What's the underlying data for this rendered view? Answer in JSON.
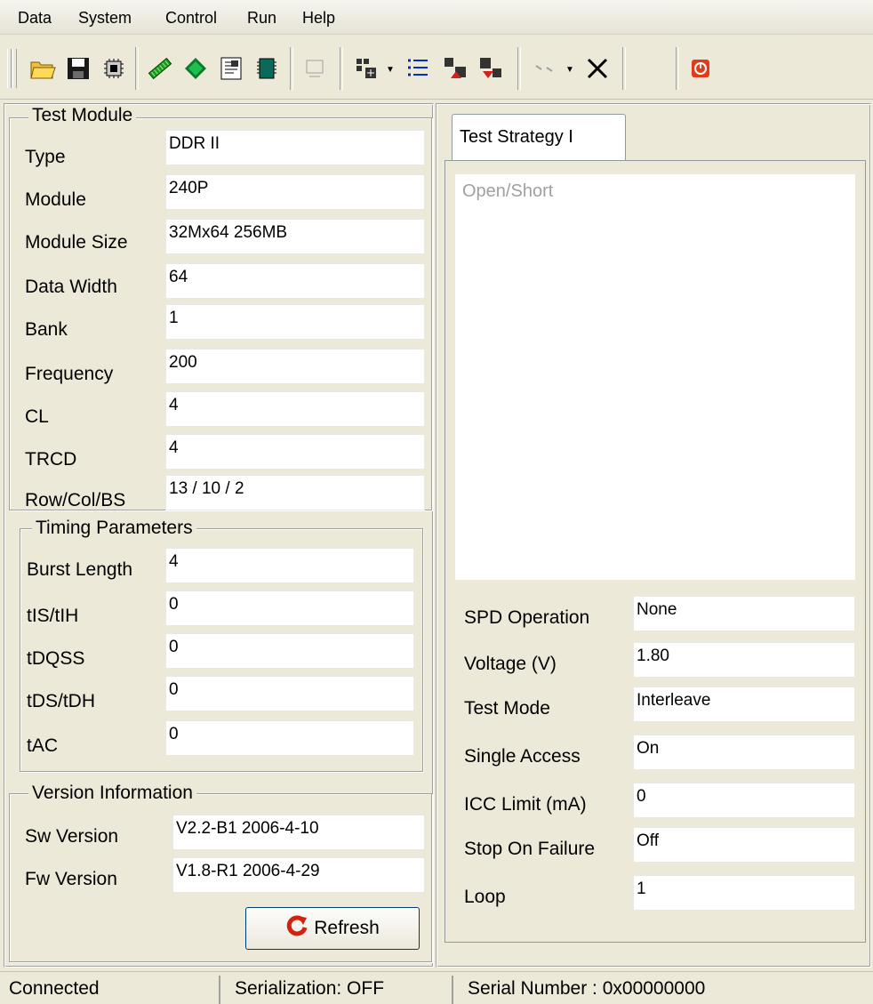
{
  "menu": [
    "Data",
    "System",
    "Control",
    "Run",
    "Help"
  ],
  "toolbar_icons": [
    "open-folder-icon",
    "save-icon",
    "chip-config-icon",
    "memory-module-icon",
    "diamond-icon",
    "document-icon",
    "chip-icon",
    "disabled-icon",
    "grid-settings-icon",
    "list-icon",
    "pattern-up-icon",
    "pattern-down-icon",
    "disabled-arrows-icon",
    "close-x-icon",
    "power-icon"
  ],
  "test_module": {
    "legend": "Test Module",
    "rows": [
      {
        "label": "Type",
        "value": "DDR II"
      },
      {
        "label": "Module",
        "value": "240P"
      },
      {
        "label": "Module Size",
        "value": "32Mx64 256MB"
      },
      {
        "label": "Data Width",
        "value": "64"
      },
      {
        "label": "Bank",
        "value": "1"
      },
      {
        "label": "Frequency",
        "value": "200"
      },
      {
        "label": "CL",
        "value": "4"
      },
      {
        "label": "TRCD",
        "value": "4"
      },
      {
        "label": "Row/Col/BS",
        "value": "13 / 10 / 2"
      }
    ]
  },
  "timing": {
    "legend": "Timing Parameters",
    "rows": [
      {
        "label": "Burst Length",
        "value": "4"
      },
      {
        "label": "tIS/tIH",
        "value": "0"
      },
      {
        "label": "tDQSS",
        "value": "0"
      },
      {
        "label": "tDS/tDH",
        "value": "0"
      },
      {
        "label": "tAC",
        "value": "0"
      }
    ]
  },
  "version": {
    "legend": "Version Information",
    "rows": [
      {
        "label": "Sw Version",
        "value": "V2.2-B1 2006-4-10"
      },
      {
        "label": "Fw Version",
        "value": "V1.8-R1 2006-4-29"
      }
    ],
    "refresh_label": "Refresh"
  },
  "strategy": {
    "tab_label": "Test Strategy I",
    "list_items": [
      "Open/Short"
    ],
    "rows": [
      {
        "label": "SPD Operation",
        "value": "None"
      },
      {
        "label": "Voltage (V)",
        "value": "1.80"
      },
      {
        "label": "Test Mode",
        "value": "Interleave"
      },
      {
        "label": "Single Access",
        "value": "On"
      },
      {
        "label": "ICC Limit (mA)",
        "value": "0"
      },
      {
        "label": "Stop On Failure",
        "value": "Off"
      },
      {
        "label": "Loop",
        "value": "1"
      }
    ]
  },
  "status": {
    "connection": "Connected",
    "serialization": "Serialization:  OFF",
    "serial_number": "Serial Number : 0x00000000"
  },
  "colors": {
    "window_bg": "#ece9d8",
    "field_bg": "#ffffff",
    "disabled_text": "#a0a0a0",
    "power_red": "#e03c1c"
  }
}
